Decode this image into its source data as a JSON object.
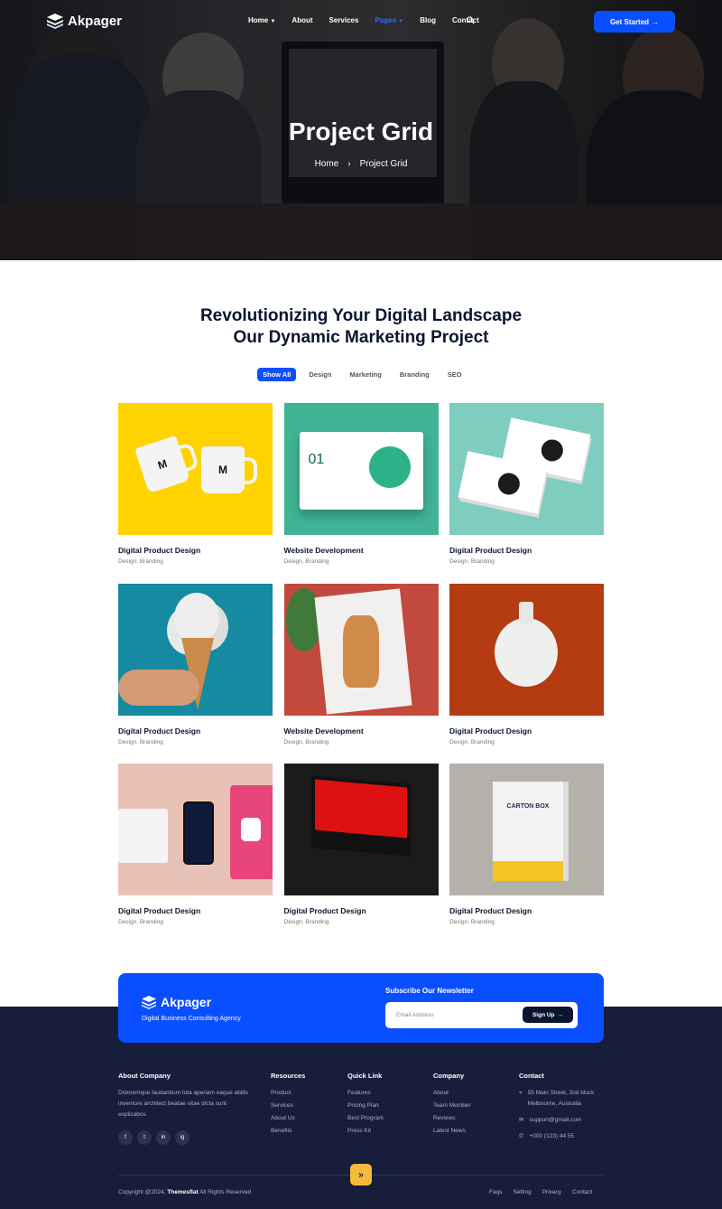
{
  "nav": {
    "logo": "Akpager",
    "items": [
      {
        "label": "Home",
        "caret": true,
        "active": false
      },
      {
        "label": "About",
        "caret": false,
        "active": false
      },
      {
        "label": "Services",
        "caret": false,
        "active": false
      },
      {
        "label": "Pages",
        "caret": true,
        "active": true
      },
      {
        "label": "Blog",
        "caret": false,
        "active": false
      },
      {
        "label": "Contact",
        "caret": false,
        "active": false
      }
    ],
    "cta": "Get Started",
    "accent": "#0a4fff"
  },
  "hero": {
    "title": "Project Grid",
    "breadcrumb": [
      "Home",
      "Project Grid"
    ]
  },
  "section": {
    "title_line1": "Revolutionizing Your Digital Landscape",
    "title_line2": "Our Dynamic Marketing Project",
    "filters": [
      "Show All",
      "Design",
      "Marketing",
      "Branding",
      "SEO"
    ],
    "projects": [
      {
        "title": "Digital Product Design",
        "category": "Design, Branding"
      },
      {
        "title": "Website Development",
        "category": "Design, Branding"
      },
      {
        "title": "Digital Product Design",
        "category": "Design, Branding"
      },
      {
        "title": "Digital Product Design",
        "category": "Design, Branding"
      },
      {
        "title": "Website Development",
        "category": "Design, Branding"
      },
      {
        "title": "Digital Product Design",
        "category": "Design, Branding"
      },
      {
        "title": "Digital Product Design",
        "category": "Design, Branding"
      },
      {
        "title": "Digital Product Design",
        "category": "Design, Branding"
      },
      {
        "title": "Digital Product Design",
        "category": "Design, Branding"
      }
    ],
    "thumb_text": {
      "mug": "M",
      "web_num": "01",
      "box": "CARTON BOX"
    }
  },
  "newsletter": {
    "logo": "Akpager",
    "tagline": "Digital Business Consulting Agency",
    "heading": "Subscribe Our Newsletter",
    "placeholder": "Email Address",
    "button": "Sign Up"
  },
  "footer": {
    "about_title": "About Company",
    "about_text": "Doloremque laudantium tota aperiam eaque abillo inventore architect beatae vitae dicta sunt explicabos",
    "social": [
      "f",
      "t",
      "in",
      "ig"
    ],
    "columns": [
      {
        "title": "Resources",
        "items": [
          "Product",
          "Services",
          "About Us",
          "Benefits"
        ]
      },
      {
        "title": "Quick Link",
        "items": [
          "Features",
          "Pricing Plan",
          "Best Program",
          "Press Kit"
        ]
      },
      {
        "title": "Company",
        "items": [
          "About",
          "Team Member",
          "Reviews",
          "Latest News"
        ]
      }
    ],
    "contact_title": "Contact",
    "address": "55 Main Street, 2nd block Melbourne, Australia",
    "email": "support@gmail.com",
    "phone": "+000 (123) 44 55",
    "copyright_pre": "Copyright @2024,",
    "copyright_brand": "Themesflat",
    "copyright_post": "All Rights Reserved",
    "bottom_links": [
      "Faqs",
      "Setting",
      "Privacy",
      "Contact"
    ],
    "bg": "#161e3b"
  }
}
